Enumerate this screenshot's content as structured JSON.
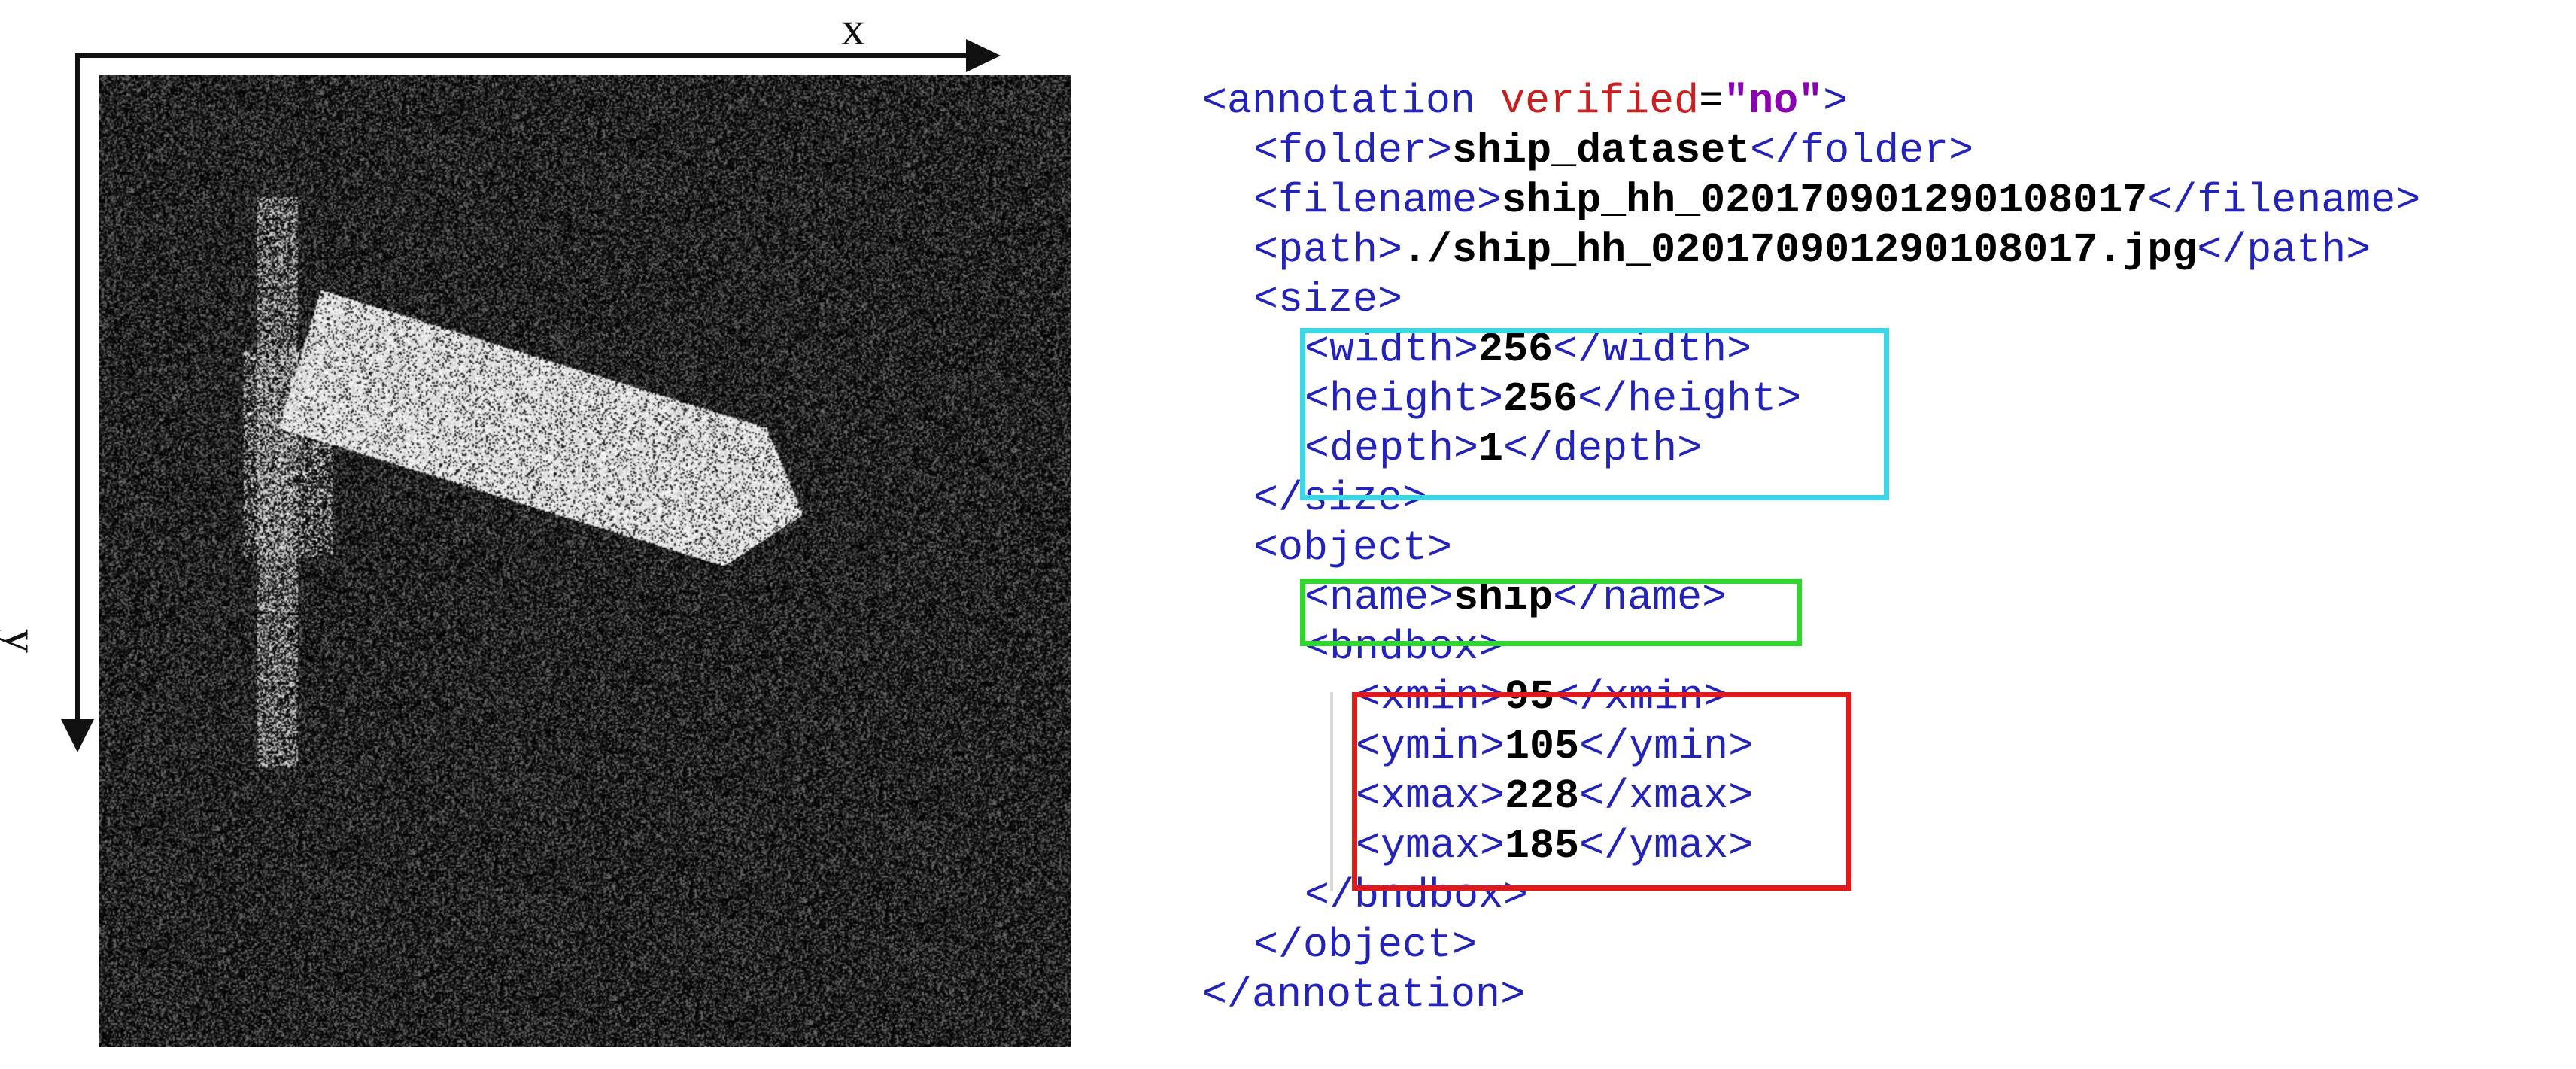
{
  "axes": {
    "x_label": "x",
    "y_label": "y",
    "color": "#111111"
  },
  "image": {
    "description_icon": "sar-ship-image",
    "background": "#0b0b0b"
  },
  "xml": {
    "lines": [
      {
        "indent": 0,
        "parts": [
          [
            "tag",
            "<annotation "
          ],
          [
            "attr",
            "verified"
          ],
          [
            "eq",
            "="
          ],
          [
            "str",
            "\"no\""
          ],
          [
            "tag",
            ">"
          ]
        ]
      },
      {
        "indent": 1,
        "parts": [
          [
            "tag",
            "<folder>"
          ],
          [
            "val",
            "ship_dataset"
          ],
          [
            "tag",
            "</folder>"
          ]
        ]
      },
      {
        "indent": 1,
        "parts": [
          [
            "tag",
            "<filename>"
          ],
          [
            "val",
            "ship_hh_020170901290108017"
          ],
          [
            "tag",
            "</filename>"
          ]
        ]
      },
      {
        "indent": 1,
        "parts": [
          [
            "tag",
            "<path>"
          ],
          [
            "val",
            "./ship_hh_020170901290108017.jpg"
          ],
          [
            "tag",
            "</path>"
          ]
        ]
      },
      {
        "indent": 1,
        "parts": [
          [
            "tag",
            "<size>"
          ]
        ]
      },
      {
        "indent": 2,
        "parts": [
          [
            "tag",
            "<width>"
          ],
          [
            "val",
            "256"
          ],
          [
            "tag",
            "</width>"
          ]
        ]
      },
      {
        "indent": 2,
        "parts": [
          [
            "tag",
            "<height>"
          ],
          [
            "val",
            "256"
          ],
          [
            "tag",
            "</height>"
          ]
        ]
      },
      {
        "indent": 2,
        "parts": [
          [
            "tag",
            "<depth>"
          ],
          [
            "val",
            "1"
          ],
          [
            "tag",
            "</depth>"
          ]
        ]
      },
      {
        "indent": 1,
        "parts": [
          [
            "tag",
            "</size>"
          ]
        ]
      },
      {
        "indent": 1,
        "parts": [
          [
            "tag",
            "<object>"
          ]
        ]
      },
      {
        "indent": 2,
        "parts": [
          [
            "tag",
            "<name>"
          ],
          [
            "val",
            "ship"
          ],
          [
            "tag",
            "</name>"
          ]
        ]
      },
      {
        "indent": 2,
        "parts": [
          [
            "tag",
            "<bndbox>"
          ]
        ]
      },
      {
        "indent": 3,
        "parts": [
          [
            "tag",
            "<xmin>"
          ],
          [
            "val",
            "95"
          ],
          [
            "tag",
            "</xmin>"
          ]
        ]
      },
      {
        "indent": 3,
        "parts": [
          [
            "tag",
            "<ymin>"
          ],
          [
            "val",
            "105"
          ],
          [
            "tag",
            "</ymin>"
          ]
        ]
      },
      {
        "indent": 3,
        "parts": [
          [
            "tag",
            "<xmax>"
          ],
          [
            "val",
            "228"
          ],
          [
            "tag",
            "</xmax>"
          ]
        ]
      },
      {
        "indent": 3,
        "parts": [
          [
            "tag",
            "<ymax>"
          ],
          [
            "val",
            "185"
          ],
          [
            "tag",
            "</ymax>"
          ]
        ]
      },
      {
        "indent": 2,
        "parts": [
          [
            "tag",
            "</bndbox>"
          ]
        ]
      },
      {
        "indent": 1,
        "parts": [
          [
            "tag",
            "</object>"
          ]
        ]
      },
      {
        "indent": 0,
        "parts": [
          [
            "tag",
            "</annotation>"
          ]
        ]
      }
    ]
  },
  "highlights": {
    "size_color": "#3cd6e6",
    "name_color": "#2ed62e",
    "bbox_color": "#e01a1a"
  }
}
